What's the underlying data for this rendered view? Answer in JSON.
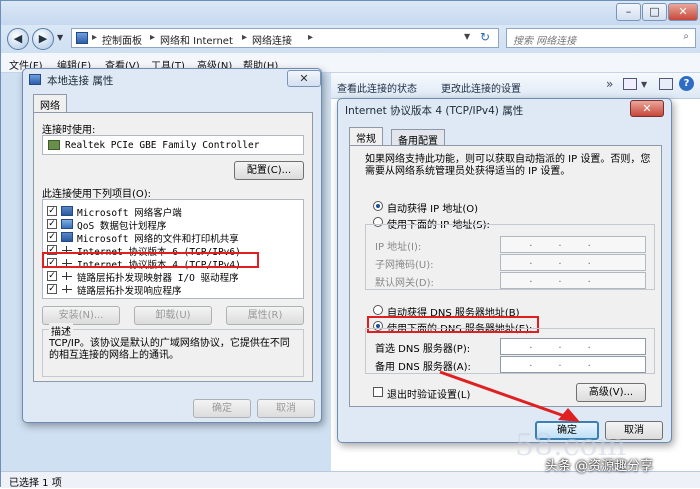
{
  "explorer": {
    "address_crumbs": [
      "控制面板",
      "网络和 Internet",
      "网络连接"
    ],
    "search_placeholder": "搜索 网络连接",
    "menu": [
      "文件(F)",
      "编辑(E)",
      "查看(V)",
      "工具(T)",
      "高级(N)",
      "帮助(H)"
    ],
    "commands": [
      "查看此连接的状态",
      "更改此连接的设置"
    ],
    "status": "已选择 1 项"
  },
  "props_dialog": {
    "title": "本地连接 属性",
    "tab": "网络",
    "connect_using_label": "连接时使用:",
    "adapter": "Realtek PCIe GBE Family Controller",
    "configure_btn": "配置(C)...",
    "items_label": "此连接使用下列项目(O):",
    "items": [
      {
        "label": "Microsoft 网络客户端",
        "checked": true,
        "icon": "network-client-icon"
      },
      {
        "label": "QoS 数据包计划程序",
        "checked": true,
        "icon": "qos-icon"
      },
      {
        "label": "Microsoft 网络的文件和打印机共享",
        "checked": true,
        "icon": "file-share-icon"
      },
      {
        "label": "Internet 协议版本 6 (TCP/IPv6)",
        "checked": true,
        "icon": "protocol-icon"
      },
      {
        "label": "Internet 协议版本 4 (TCP/IPv4)",
        "checked": true,
        "icon": "protocol-icon"
      },
      {
        "label": "链路层拓扑发现映射器 I/O 驱动程序",
        "checked": true,
        "icon": "protocol-icon"
      },
      {
        "label": "链路层拓扑发现响应程序",
        "checked": true,
        "icon": "protocol-icon"
      }
    ],
    "install_btn": "安装(N)...",
    "uninstall_btn": "卸载(U)",
    "properties_btn": "属性(R)",
    "description_label": "描述",
    "description": "TCP/IP。该协议是默认的广域网络协议，它提供在不同的相互连接的网络上的通讯。",
    "ok_btn": "确定",
    "cancel_btn": "取消"
  },
  "ipv4_dialog": {
    "title": "Internet 协议版本 4 (TCP/IPv4) 属性",
    "tabs": [
      "常规",
      "备用配置"
    ],
    "intro": "如果网络支持此功能，则可以获取自动指派的 IP 设置。否则，您需要从网络系统管理员处获得适当的 IP 设置。",
    "auto_ip": "自动获得 IP 地址(O)",
    "use_ip": "使用下面的 IP 地址(S):",
    "ip_fields": [
      "IP 地址(I):",
      "子网掩码(U):",
      "默认网关(D):"
    ],
    "auto_dns": "自动获得 DNS 服务器地址(B)",
    "use_dns": "使用下面的 DNS 服务器地址(E):",
    "dns_fields": [
      "首选 DNS 服务器(P):",
      "备用 DNS 服务器(A):"
    ],
    "validate_on_exit": "退出时验证设置(L)",
    "advanced_btn": "高级(V)...",
    "ok_btn": "确定",
    "cancel_btn": "取消"
  },
  "watermark": {
    "site": "58.com",
    "caption": "头条 @资源趣分享"
  }
}
